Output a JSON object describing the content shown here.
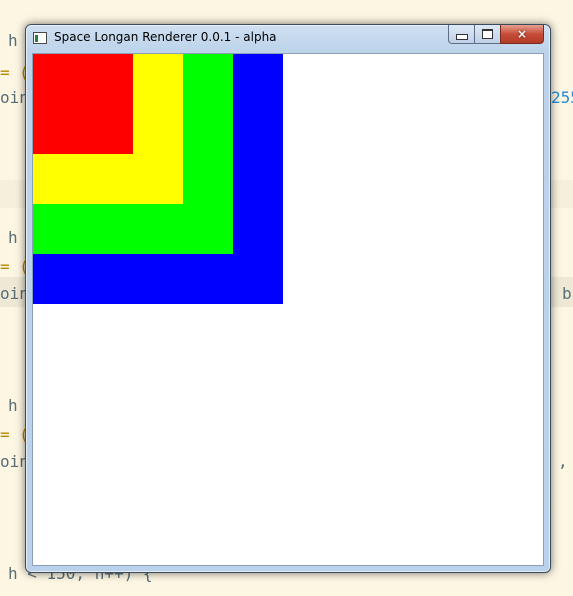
{
  "background_editor": {
    "fragments": [
      {
        "name": "code-fragment-1",
        "text": "h"
      },
      {
        "name": "code-fragment-2",
        "text": "= ("
      },
      {
        "name": "code-fragment-3",
        "text": "oin"
      },
      {
        "name": "code-fragment-4",
        "text": "255"
      },
      {
        "name": "code-fragment-5",
        "text": "h"
      },
      {
        "name": "code-fragment-6",
        "text": "= ("
      },
      {
        "name": "code-fragment-7",
        "text": "oin"
      },
      {
        "name": "code-fragment-8",
        "text": "b"
      },
      {
        "name": "code-fragment-9",
        "text": "h"
      },
      {
        "name": "code-fragment-10",
        "text": "= ("
      },
      {
        "name": "code-fragment-11",
        "text": "oin"
      },
      {
        "name": "code-fragment-12",
        "text": ","
      },
      {
        "name": "code-fragment-13",
        "text": "h < 150; h++) {"
      }
    ]
  },
  "window": {
    "title": "Space Longan Renderer 0.0.1 - alpha",
    "icon": "app-window-icon",
    "buttons": {
      "minimize": "minimize-icon",
      "maximize": "maximize-icon",
      "close": "×"
    }
  },
  "canvas": {
    "background": "#ffffff",
    "squares": [
      {
        "name": "blue-square",
        "color": "#0000ff"
      },
      {
        "name": "green-square",
        "color": "#00ff00"
      },
      {
        "name": "yellow-square",
        "color": "#ffff00"
      },
      {
        "name": "red-square",
        "color": "#ff0000"
      }
    ]
  }
}
